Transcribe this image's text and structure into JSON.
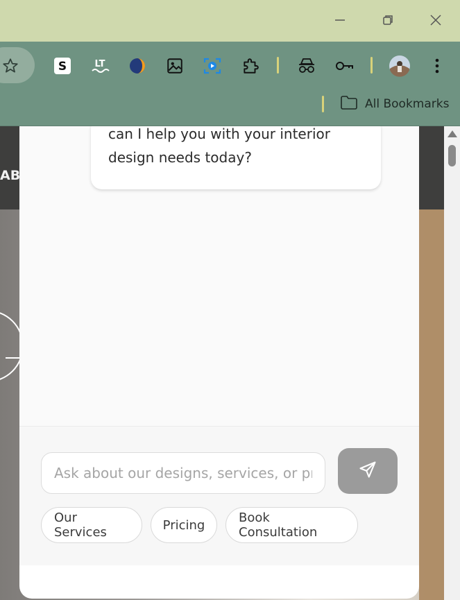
{
  "window": {
    "controls": [
      {
        "name": "minimize-icon"
      },
      {
        "name": "restore-icon"
      },
      {
        "name": "close-icon"
      }
    ]
  },
  "toolbar": {
    "extensions": [
      {
        "name": "bookmark-star-icon"
      },
      {
        "name": "scribe-extension-icon",
        "glyph": "S"
      },
      {
        "name": "languagetool-extension-icon",
        "glyph": "LT"
      },
      {
        "name": "crescent-extension-icon"
      },
      {
        "name": "image-extension-icon"
      },
      {
        "name": "screen-capture-extension-icon"
      },
      {
        "name": "extensions-puzzle-icon"
      },
      {
        "name": "incognito-spy-icon"
      },
      {
        "name": "password-key-icon"
      },
      {
        "name": "profile-avatar"
      },
      {
        "name": "more-menu-icon"
      }
    ]
  },
  "bookmarks_bar": {
    "folder_label": "All Bookmarks"
  },
  "page": {
    "header_text": "AB"
  },
  "chat": {
    "bot_message": "can I help you with your interior design needs today?",
    "input_placeholder": "Ask about our designs, services, or pricing...",
    "input_value": "",
    "quick_replies": [
      "Our Services",
      "Pricing",
      "Book Consultation"
    ]
  },
  "colors": {
    "titlebar": "#cfd9ad",
    "toolbar": "#6f9382",
    "send_button": "#9b9b9b"
  }
}
